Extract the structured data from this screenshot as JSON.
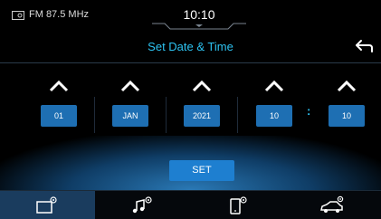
{
  "status": {
    "radio_label": "FM 87.5 MHz",
    "clock": "10:10"
  },
  "header": {
    "title": "Set Date & Time"
  },
  "pickers": [
    {
      "field": "day",
      "value": "01"
    },
    {
      "field": "month",
      "value": "JAN"
    },
    {
      "field": "year",
      "value": "2021"
    },
    {
      "field": "hour",
      "value": "10"
    },
    {
      "field": "minute",
      "value": "10"
    }
  ],
  "time_separator": ":",
  "set_button": "SET",
  "nav": [
    {
      "icon": "home-settings-icon",
      "active": true
    },
    {
      "icon": "audio-settings-icon",
      "active": false
    },
    {
      "icon": "phone-settings-icon",
      "active": false
    },
    {
      "icon": "vehicle-settings-icon",
      "active": false
    }
  ],
  "colors": {
    "accent": "#2dc2f0",
    "value_bg": "#1e6fb3",
    "button_bg": "#1e7fd0"
  }
}
